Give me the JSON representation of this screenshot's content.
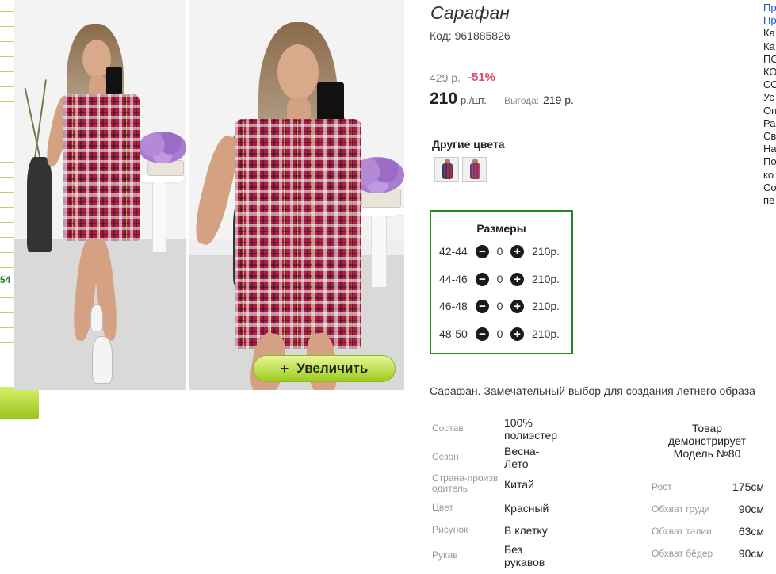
{
  "product": {
    "title": "Сарафан",
    "code_label": "Код:",
    "code": "961885826",
    "old_price": "429 р.",
    "discount": "-51%",
    "price": "210",
    "price_unit": "р./шт.",
    "savings_label": "Выгода:",
    "savings_value": "219 р.",
    "description": "Сарафан. Замечательный выбор для создания летнего образа"
  },
  "gallery": {
    "zoom_label": "Увеличить",
    "zoom_icon": "+"
  },
  "left_strip": {
    "partial_number": "54"
  },
  "other_colors": {
    "title": "Другие цвета",
    "swatches": [
      "swatch-1",
      "swatch-2"
    ]
  },
  "sizes": {
    "title": "Размеры",
    "rows": [
      {
        "size": "42-44",
        "qty": "0",
        "price": "210р."
      },
      {
        "size": "44-46",
        "qty": "0",
        "price": "210р."
      },
      {
        "size": "46-48",
        "qty": "0",
        "price": "210р."
      },
      {
        "size": "48-50",
        "qty": "0",
        "price": "210р."
      }
    ],
    "minus_icon": "−",
    "plus_icon": "+"
  },
  "attributes": [
    {
      "label": "Состав",
      "value": "100% полиэстер"
    },
    {
      "label": "Сезон",
      "value": "Весна-Лето"
    },
    {
      "label": "Страна-производитель",
      "value": "Китай"
    },
    {
      "label": "Цвет",
      "value": "Красный"
    },
    {
      "label": "Рисунок",
      "value": "В клетку"
    },
    {
      "label": "Рукав",
      "value": "Без рукавов"
    }
  ],
  "model": {
    "title": "Товар демонстрирует Модель №80",
    "measurements": [
      {
        "label": "Рост",
        "value": "175см"
      },
      {
        "label": "Обхват груди",
        "value": "90см"
      },
      {
        "label": "Обхват талии",
        "value": "63см"
      },
      {
        "label": "Обхват бёдер",
        "value": "90см"
      }
    ]
  },
  "right_column": {
    "items": [
      "Пр",
      "Пр",
      "Ка",
      "Ка",
      "ПО",
      "КО",
      "СО",
      "Ус",
      "Оп",
      "Ра",
      "Св",
      "На",
      "По",
      "ко",
      "Со",
      "пе"
    ]
  },
  "colors": {
    "accent_green": "#1f8a24",
    "zoom_button": "#9ccb1c",
    "discount_pink": "#e14a6a",
    "link_blue": "#1a4fd1"
  }
}
